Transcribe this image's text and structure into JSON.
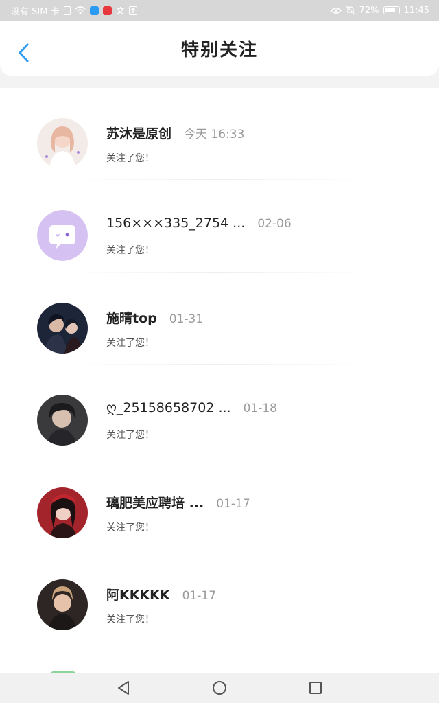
{
  "status_bar": {
    "carrier": "没有 SIM 卡",
    "battery_percent": "72%",
    "time": "11:45"
  },
  "header": {
    "title": "特别关注"
  },
  "notifications": [
    {
      "name": "苏沐是原创",
      "time": "今天 16:33",
      "message": "关注了您！"
    },
    {
      "name": "156×××335_2754 ...",
      "time": "02-06",
      "message": "关注了您！"
    },
    {
      "name": "施晴top",
      "time": "01-31",
      "message": "关注了您！"
    },
    {
      "name": "ღ_25158658702 ...",
      "time": "01-18",
      "message": "关注了您！"
    },
    {
      "name": "璃肥美应聘培 ...",
      "time": "01-17",
      "message": "关注了您！"
    },
    {
      "name": "阿KKKKK",
      "time": "01-17",
      "message": "关注了您！"
    }
  ],
  "colors": {
    "accent": "#2b9af3",
    "header_bg": "#ffffff",
    "status_bar_bg": "#d7d7d8"
  }
}
